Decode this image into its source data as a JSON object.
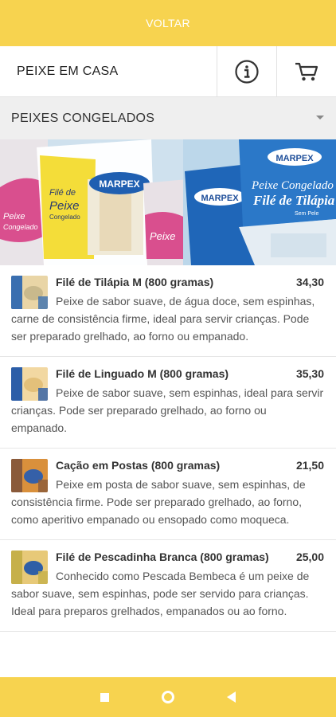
{
  "topbar": {
    "back_label": "VOLTAR"
  },
  "header": {
    "store_name": "PEIXE EM CASA",
    "info_icon": "info-circle-icon",
    "cart_icon": "shopping-cart-icon"
  },
  "category": {
    "selected": "PEIXES CONGELADOS"
  },
  "banner": {
    "brand": "MARPEX",
    "texts": [
      "Peixe Congelado",
      "Filé de Tilápia",
      "Sem Pele",
      "Filé de",
      "Peixe",
      "Congelado",
      "Peixe",
      "Congelado"
    ]
  },
  "products": [
    {
      "name": "Filé de Tilápia M (800 gramas)",
      "price": "34,30",
      "description": "Peixe de sabor suave, de água doce, sem espinhas, carne de consistência firme, ideal para servir crianças. Pode ser preparado grelhado, ao forno ou empanado."
    },
    {
      "name": "Filé de Linguado M (800 gramas)",
      "price": "35,30",
      "description": "Peixe de sabor suave, sem espinhas, ideal para servir crianças. Pode ser preparado grelhado, ao forno ou empanado."
    },
    {
      "name": "Cação em Postas (800 gramas)",
      "price": "21,50",
      "description": "Peixe em posta de sabor suave, sem espinhas, de consistência firme. Pode ser preparado grelhado, ao forno, como aperitivo empanado ou ensopado como moqueca."
    },
    {
      "name": "Filé de Pescadinha Branca (800 gramas)",
      "price": "25,00",
      "description": "Conhecido como Pescada Bembeca é um peixe de sabor suave, sem espinhas, pode ser servido para crianças. Ideal para preparos grelhados, empanados ou ao forno."
    }
  ],
  "colors": {
    "accent": "#f7d34f",
    "category_bg": "#efefef"
  }
}
